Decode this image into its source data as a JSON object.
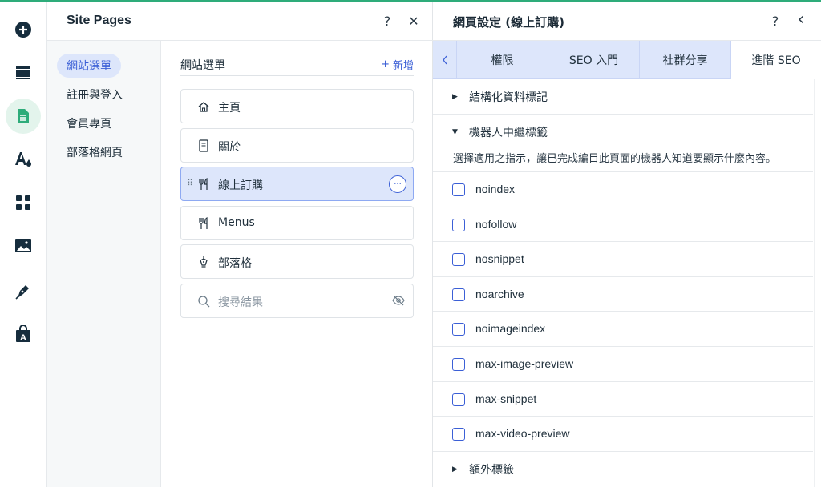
{
  "rail": {
    "items": [
      {
        "name": "add-icon"
      },
      {
        "name": "menus-icon"
      },
      {
        "name": "pages-icon"
      },
      {
        "name": "design-icon"
      },
      {
        "name": "apps-icon"
      },
      {
        "name": "media-icon"
      },
      {
        "name": "blog-pen-icon"
      },
      {
        "name": "app-market-icon"
      }
    ]
  },
  "site_pages": {
    "title": "Site Pages",
    "help": "?",
    "close": "✕",
    "categories": [
      "網站選單",
      "註冊與登入",
      "會員專頁",
      "部落格網頁"
    ],
    "list_title": "網站選單",
    "add_label": "新增",
    "pages": [
      {
        "label": "主頁",
        "icon": "home-icon"
      },
      {
        "label": "關於",
        "icon": "page-icon"
      },
      {
        "label": "線上訂購",
        "icon": "restaurant-icon"
      },
      {
        "label": "Menus",
        "icon": "restaurant-icon"
      },
      {
        "label": "部落格",
        "icon": "pen-nib-icon"
      },
      {
        "label": "搜尋結果",
        "icon": "search-icon"
      }
    ],
    "more": "···"
  },
  "settings": {
    "title": "網頁設定 (線上訂購)",
    "help": "?",
    "back": "‹",
    "tabs": [
      "權限",
      "SEO 入門",
      "社群分享",
      "進階 SEO"
    ],
    "active_tab": "進階 SEO",
    "sections": {
      "structured": "結構化資料標記",
      "robots": "機器人中繼標籤",
      "extra": "額外標籤"
    },
    "robots_description": "選擇適用之指示，讓已完成編目此頁面的機器人知道要顯示什麼內容。",
    "options": [
      "noindex",
      "nofollow",
      "nosnippet",
      "noarchive",
      "noimageindex",
      "max-image-preview",
      "max-snippet",
      "max-video-preview"
    ]
  },
  "colors": {
    "accent": "#3b5fd6",
    "selected_bg": "#dde6fb",
    "rail_active": "#e3f4ec",
    "brand_green": "#2eac7a"
  }
}
